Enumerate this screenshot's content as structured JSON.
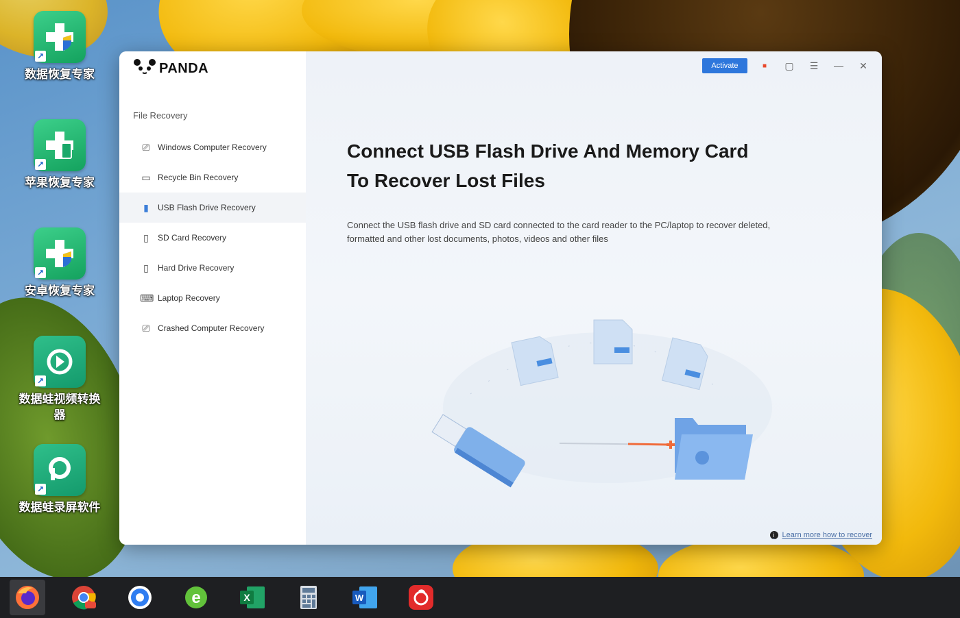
{
  "desktop": {
    "icons": [
      {
        "label": "数据恢复专家"
      },
      {
        "label": "苹果恢复专家"
      },
      {
        "label": "安卓恢复专家"
      },
      {
        "label": "数据蛙视频转换器"
      },
      {
        "label": "数据蛙录屏软件"
      }
    ]
  },
  "window": {
    "app_name": "PANDA",
    "activate_label": "Activate",
    "section_title": "File Recovery",
    "nav": [
      {
        "label": "Windows Computer Recovery",
        "icon": "computer-icon"
      },
      {
        "label": "Recycle Bin Recovery",
        "icon": "recycle-bin-icon"
      },
      {
        "label": "USB Flash Drive Recovery",
        "icon": "usb-drive-icon"
      },
      {
        "label": "SD Card Recovery",
        "icon": "sd-card-icon"
      },
      {
        "label": "Hard Drive Recovery",
        "icon": "hard-drive-icon"
      },
      {
        "label": "Laptop Recovery",
        "icon": "laptop-icon"
      },
      {
        "label": "Crashed Computer Recovery",
        "icon": "crashed-computer-icon"
      }
    ],
    "headline_line1": "Connect USB Flash Drive And Memory Card",
    "headline_line2": "To Recover Lost Files",
    "description": "Connect the USB flash drive and SD card connected to the card reader to the PC/laptop to recover deleted, formatted and other lost documents, photos, videos and other files",
    "footer_link": "Learn more how to recover"
  },
  "colors": {
    "accent": "#2e77dc",
    "taskbar": "#1e1f22"
  }
}
